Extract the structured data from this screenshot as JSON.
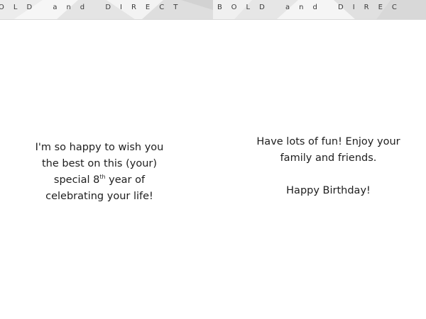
{
  "banner": {
    "left_text": "OLD and DIRECT",
    "right_text": "BOLD and DIREC"
  },
  "left_message": {
    "line1": "I'm so happy to wish you",
    "line2": "the best on this (your)",
    "line3_before": "special 8",
    "line3_ordinal": "th",
    "line3_after": " year of",
    "line4": "celebrating your life!"
  },
  "right_message": {
    "line1": "Have lots of fun!  Enjoy your",
    "line2": "family and friends.",
    "line3": "Happy Birthday!"
  },
  "colors": {
    "text": "#1e1e1e",
    "banner_text": "#3a3a3a",
    "banner_facet_light": "#ececec",
    "banner_facet_dark": "#d6d6d6"
  }
}
